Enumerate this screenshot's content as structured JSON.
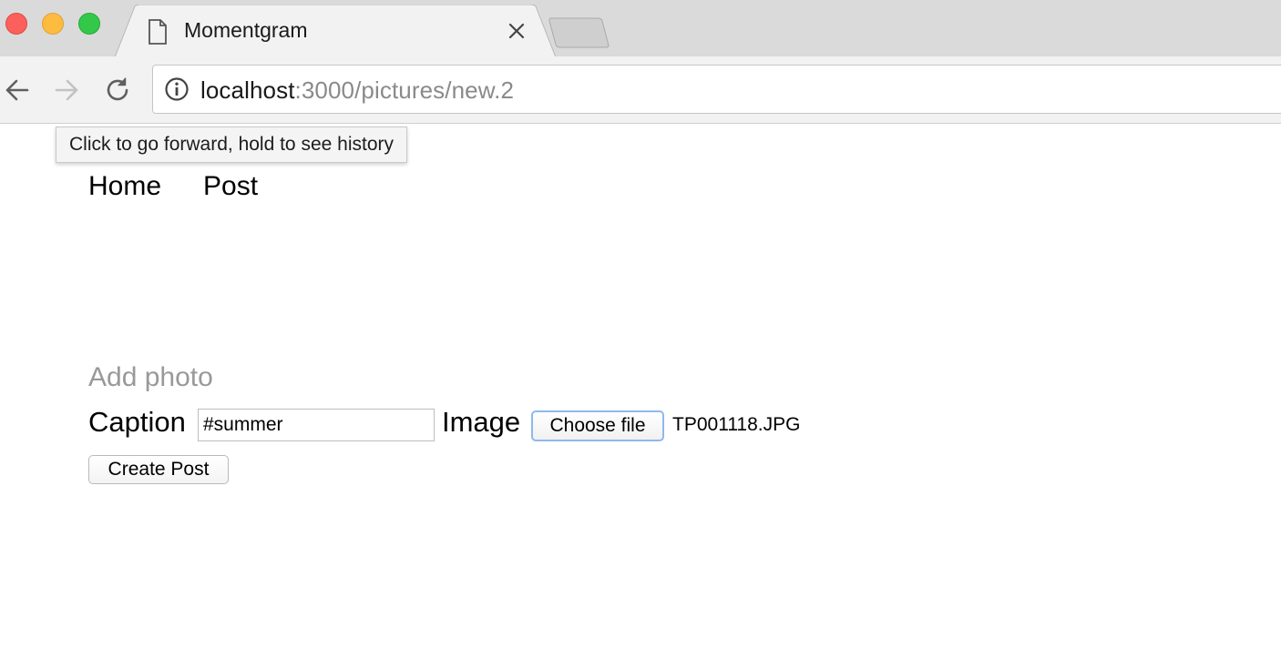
{
  "browser": {
    "tab": {
      "title": "Momentgram",
      "icon": "page-icon"
    },
    "address_bar": {
      "host": "localhost",
      "rest": ":3000/pictures/new.2"
    },
    "tooltip": "Click to go forward, hold to see history",
    "controls": {
      "back_icon": "arrow-left-icon",
      "forward_icon": "arrow-right-icon",
      "reload_icon": "reload-icon",
      "info_icon": "info-icon",
      "close_icon": "close-icon"
    },
    "colors": {
      "traffic_red": "#fc605c",
      "traffic_yellow": "#fdbc40",
      "traffic_green": "#34c84a"
    }
  },
  "page": {
    "nav": {
      "home": "Home",
      "post": "Post"
    },
    "heading": "Add photo",
    "form": {
      "caption_label": "Caption",
      "caption_value": "#summer",
      "image_label": "Image",
      "choose_file_label": "Choose file",
      "file_name": "TP001118.JPG",
      "submit_label": "Create Post"
    },
    "colors": {
      "heading": "#999999",
      "focus_ring": "#8fb8ef"
    }
  }
}
